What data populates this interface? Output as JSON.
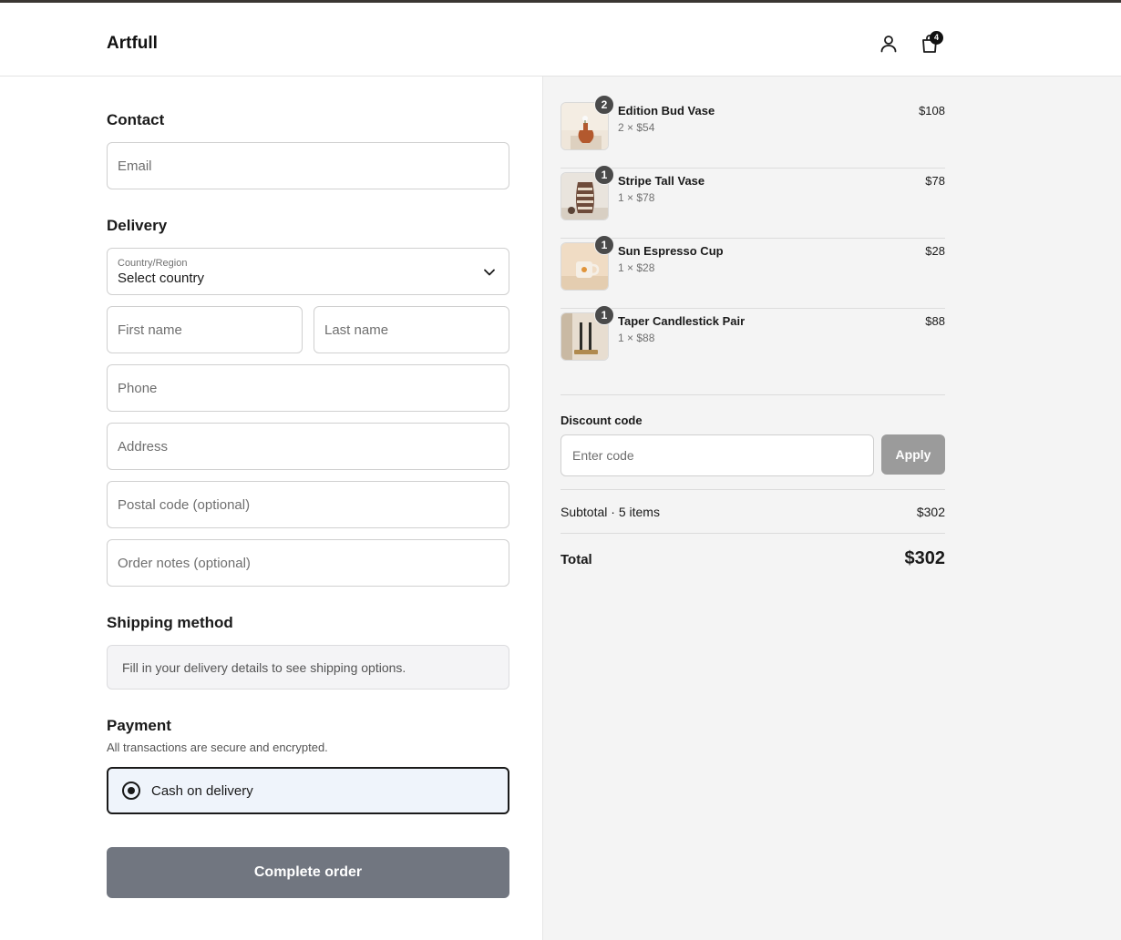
{
  "header": {
    "logo": "Artfull",
    "account_icon": "user-icon",
    "cart_icon": "shopping-bag-icon",
    "cart_count": "4"
  },
  "contact": {
    "title": "Contact",
    "email_placeholder": "Email"
  },
  "delivery": {
    "title": "Delivery",
    "country_label": "Country/Region",
    "country_value": "Select country",
    "first_name_placeholder": "First name",
    "last_name_placeholder": "Last name",
    "phone_placeholder": "Phone",
    "address_placeholder": "Address",
    "postal_placeholder": "Postal code (optional)",
    "notes_placeholder": "Order notes (optional)"
  },
  "shipping": {
    "title": "Shipping method",
    "note": "Fill in your delivery details to see shipping options."
  },
  "payment": {
    "title": "Payment",
    "subtitle": "All transactions are secure and encrypted.",
    "option": "Cash on delivery"
  },
  "complete_button": "Complete order",
  "cart": {
    "items": [
      {
        "name": "Edition Bud Vase",
        "qty_badge": "2",
        "qty_line": "2 × $54",
        "price": "$108"
      },
      {
        "name": "Stripe Tall Vase",
        "qty_badge": "1",
        "qty_line": "1 × $78",
        "price": "$78"
      },
      {
        "name": "Sun Espresso Cup",
        "qty_badge": "1",
        "qty_line": "1 × $28",
        "price": "$28"
      },
      {
        "name": "Taper Candlestick Pair",
        "qty_badge": "1",
        "qty_line": "1 × $88",
        "price": "$88"
      }
    ]
  },
  "discount": {
    "label": "Discount code",
    "placeholder": "Enter code",
    "apply": "Apply"
  },
  "summary": {
    "subtotal_label": "Subtotal · 5 items",
    "subtotal_value": "$302",
    "total_label": "Total",
    "total_value": "$302"
  },
  "colors": {
    "accent": "#1a1a1a",
    "button_disabled": "#717680",
    "sidebar_bg": "#f4f4f4"
  }
}
